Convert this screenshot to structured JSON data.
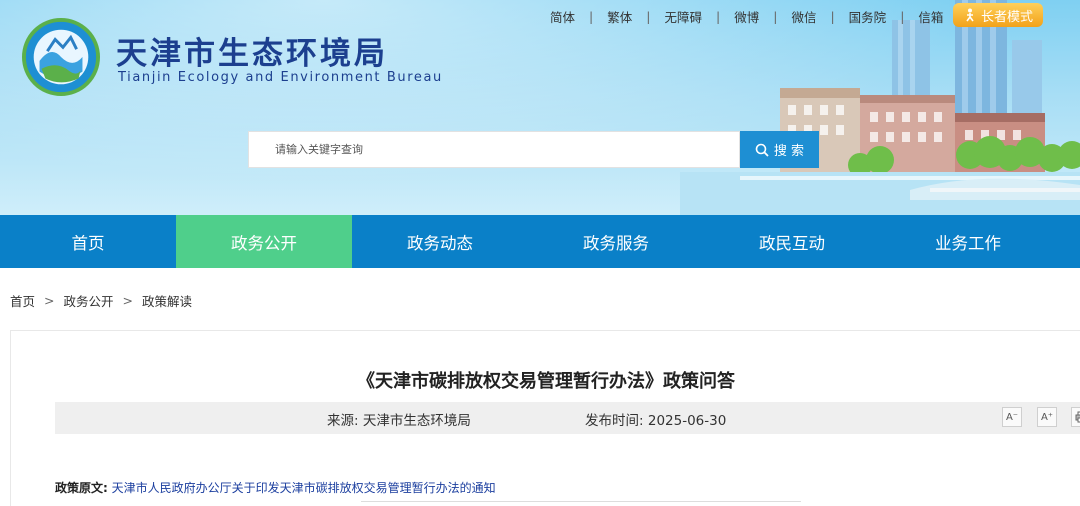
{
  "header": {
    "site_title": "天津市生态环境局",
    "site_subtitle": "Tianjin Ecology and Environment Bureau",
    "top_links": [
      "简体",
      "繁体",
      "无障碍",
      "微博",
      "微信",
      "国务院",
      "信箱"
    ],
    "elder_mode": "长者模式",
    "search": {
      "placeholder": "请输入关键字查询",
      "button": "搜 索"
    }
  },
  "nav": {
    "items": [
      "首页",
      "政务公开",
      "政务动态",
      "政务服务",
      "政民互动",
      "业务工作"
    ],
    "active_index": 1
  },
  "breadcrumb": [
    "首页",
    "政务公开",
    "政策解读"
  ],
  "article": {
    "title": "《天津市碳排放权交易管理暂行办法》政策问答",
    "source_label": "来源:",
    "source": "天津市生态环境局",
    "date_label": "发布时间:",
    "date": "2025-06-30",
    "font_decrease": "A⁻",
    "font_increase": "A⁺",
    "policy_label": "政策原文:",
    "policy_link": "天津市人民政府办公厅关于印发天津市碳排放权交易管理暂行办法的通知"
  },
  "colors": {
    "nav_bg": "#0a80c8",
    "nav_active": "#4fcf8b",
    "title_blue": "#1c3f8f",
    "search_btn": "#1e8fd3",
    "elder_btn": "#f2a21a"
  },
  "icons": [
    "logo-emblem-icon",
    "search-icon",
    "elder-mode-icon",
    "font-decrease-icon",
    "font-increase-icon",
    "print-icon"
  ]
}
